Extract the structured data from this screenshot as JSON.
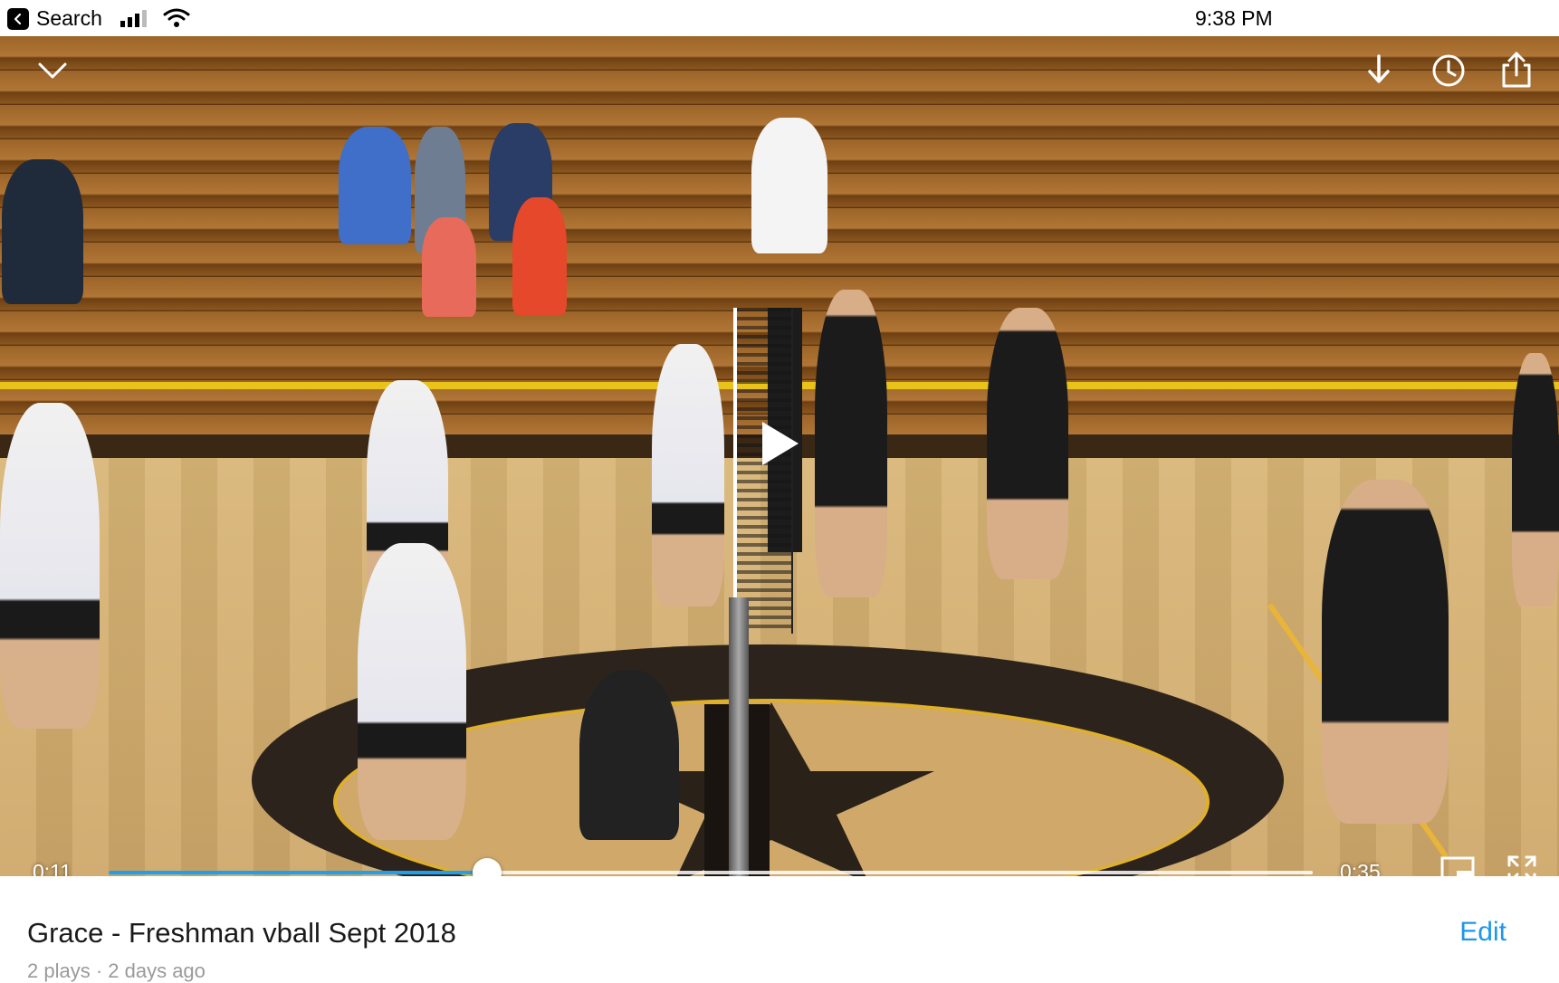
{
  "status_bar": {
    "back_label": "Search",
    "time": "9:38 PM"
  },
  "video": {
    "current_time": "0:11",
    "duration": "0:35",
    "progress": 0.314,
    "accent_color": "#1ea0ef"
  },
  "icons": {
    "collapse": "chevron-down-icon",
    "download": "download-icon",
    "watch_later": "clock-icon",
    "share": "share-icon",
    "play": "play-icon",
    "pip": "picture-in-picture-icon",
    "fullscreen": "fullscreen-icon"
  },
  "info": {
    "title": "Grace - Freshman vball Sept 2018",
    "edit_label": "Edit",
    "meta": "2 plays · 2 days ago"
  }
}
